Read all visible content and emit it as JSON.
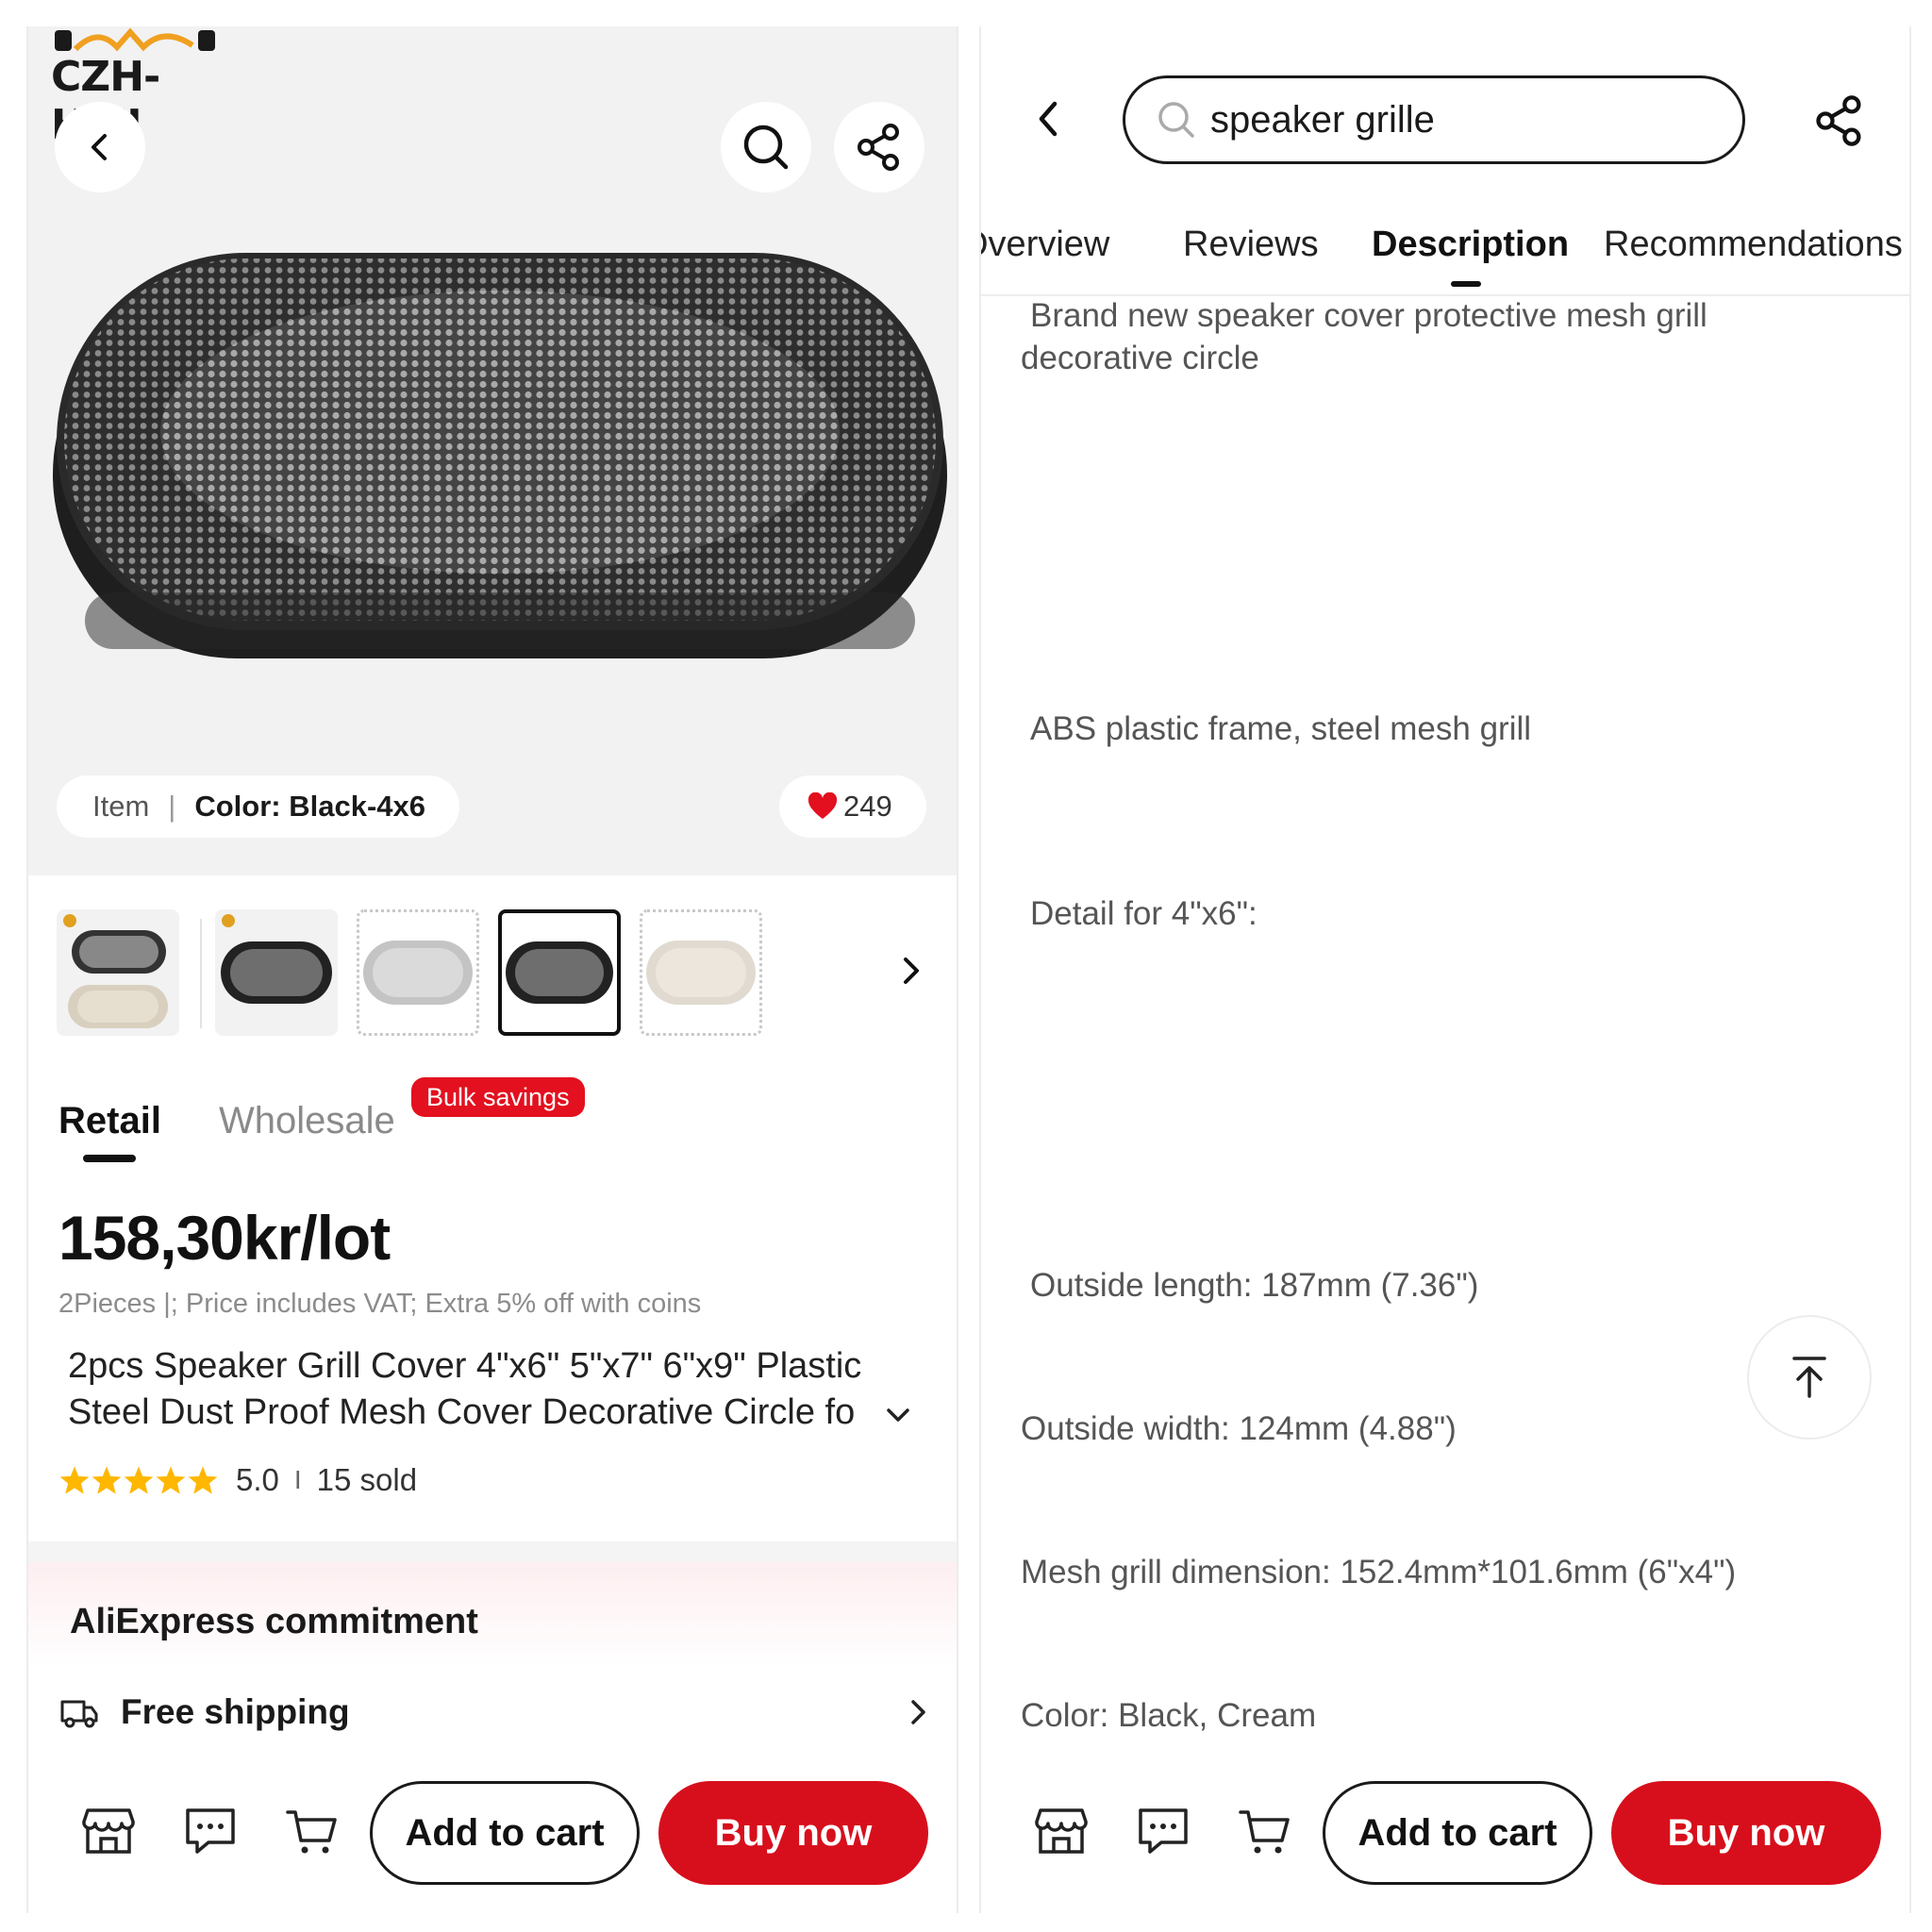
{
  "left": {
    "store_logo_text": "CZH-HIFI",
    "item_label": "Item",
    "color_label": "Color: Black-4x6",
    "likes": "249",
    "tabs": {
      "retail": "Retail",
      "wholesale": "Wholesale",
      "bulk_badge": "Bulk savings"
    },
    "price": "158,30kr/lot",
    "price_note": "2Pieces |; Price includes VAT; Extra 5% off with coins",
    "title_line1": "2pcs Speaker Grill Cover 4\"x6\" 5\"x7\" 6\"x9\" Plastic",
    "title_line2": "Steel Dust Proof Mesh Cover Decorative Circle fo",
    "rating": "5.0",
    "rating_stars": 5,
    "sold": "15 sold",
    "commitment_title": "AliExpress commitment",
    "shipping": "Free shipping",
    "add_to_cart": "Add to cart",
    "buy_now": "Buy now"
  },
  "right": {
    "search_value": "speaker grille",
    "tabs": [
      "Overview",
      "Reviews",
      "Description",
      "Recommendations"
    ],
    "active_tab": "Description",
    "desc_intro_line1": "Brand new speaker cover protective mesh grill",
    "desc_intro_line2": "decorative circle",
    "desc_material": "ABS plastic frame, steel mesh grill",
    "desc_detail": "Detail for 4\"x6\":",
    "desc_length": "Outside length: 187mm (7.36\")",
    "desc_width": "Outside width: 124mm (4.88\")",
    "desc_mesh": "Mesh grill dimension: 152.4mm*101.6mm (6\"x4\")",
    "desc_color": "Color: Black, Cream",
    "add_to_cart": "Add to cart",
    "buy_now": "Buy now"
  },
  "colors": {
    "accent_red": "#d70f1c",
    "star_yellow": "#ffb700",
    "heart_red": "#e3101f"
  },
  "icons": [
    "back-icon",
    "search-icon",
    "share-icon",
    "heart-icon",
    "chevron-right-icon",
    "chevron-down-icon",
    "star-icon",
    "truck-icon",
    "store-icon",
    "message-icon",
    "cart-icon",
    "back-to-top-icon"
  ]
}
